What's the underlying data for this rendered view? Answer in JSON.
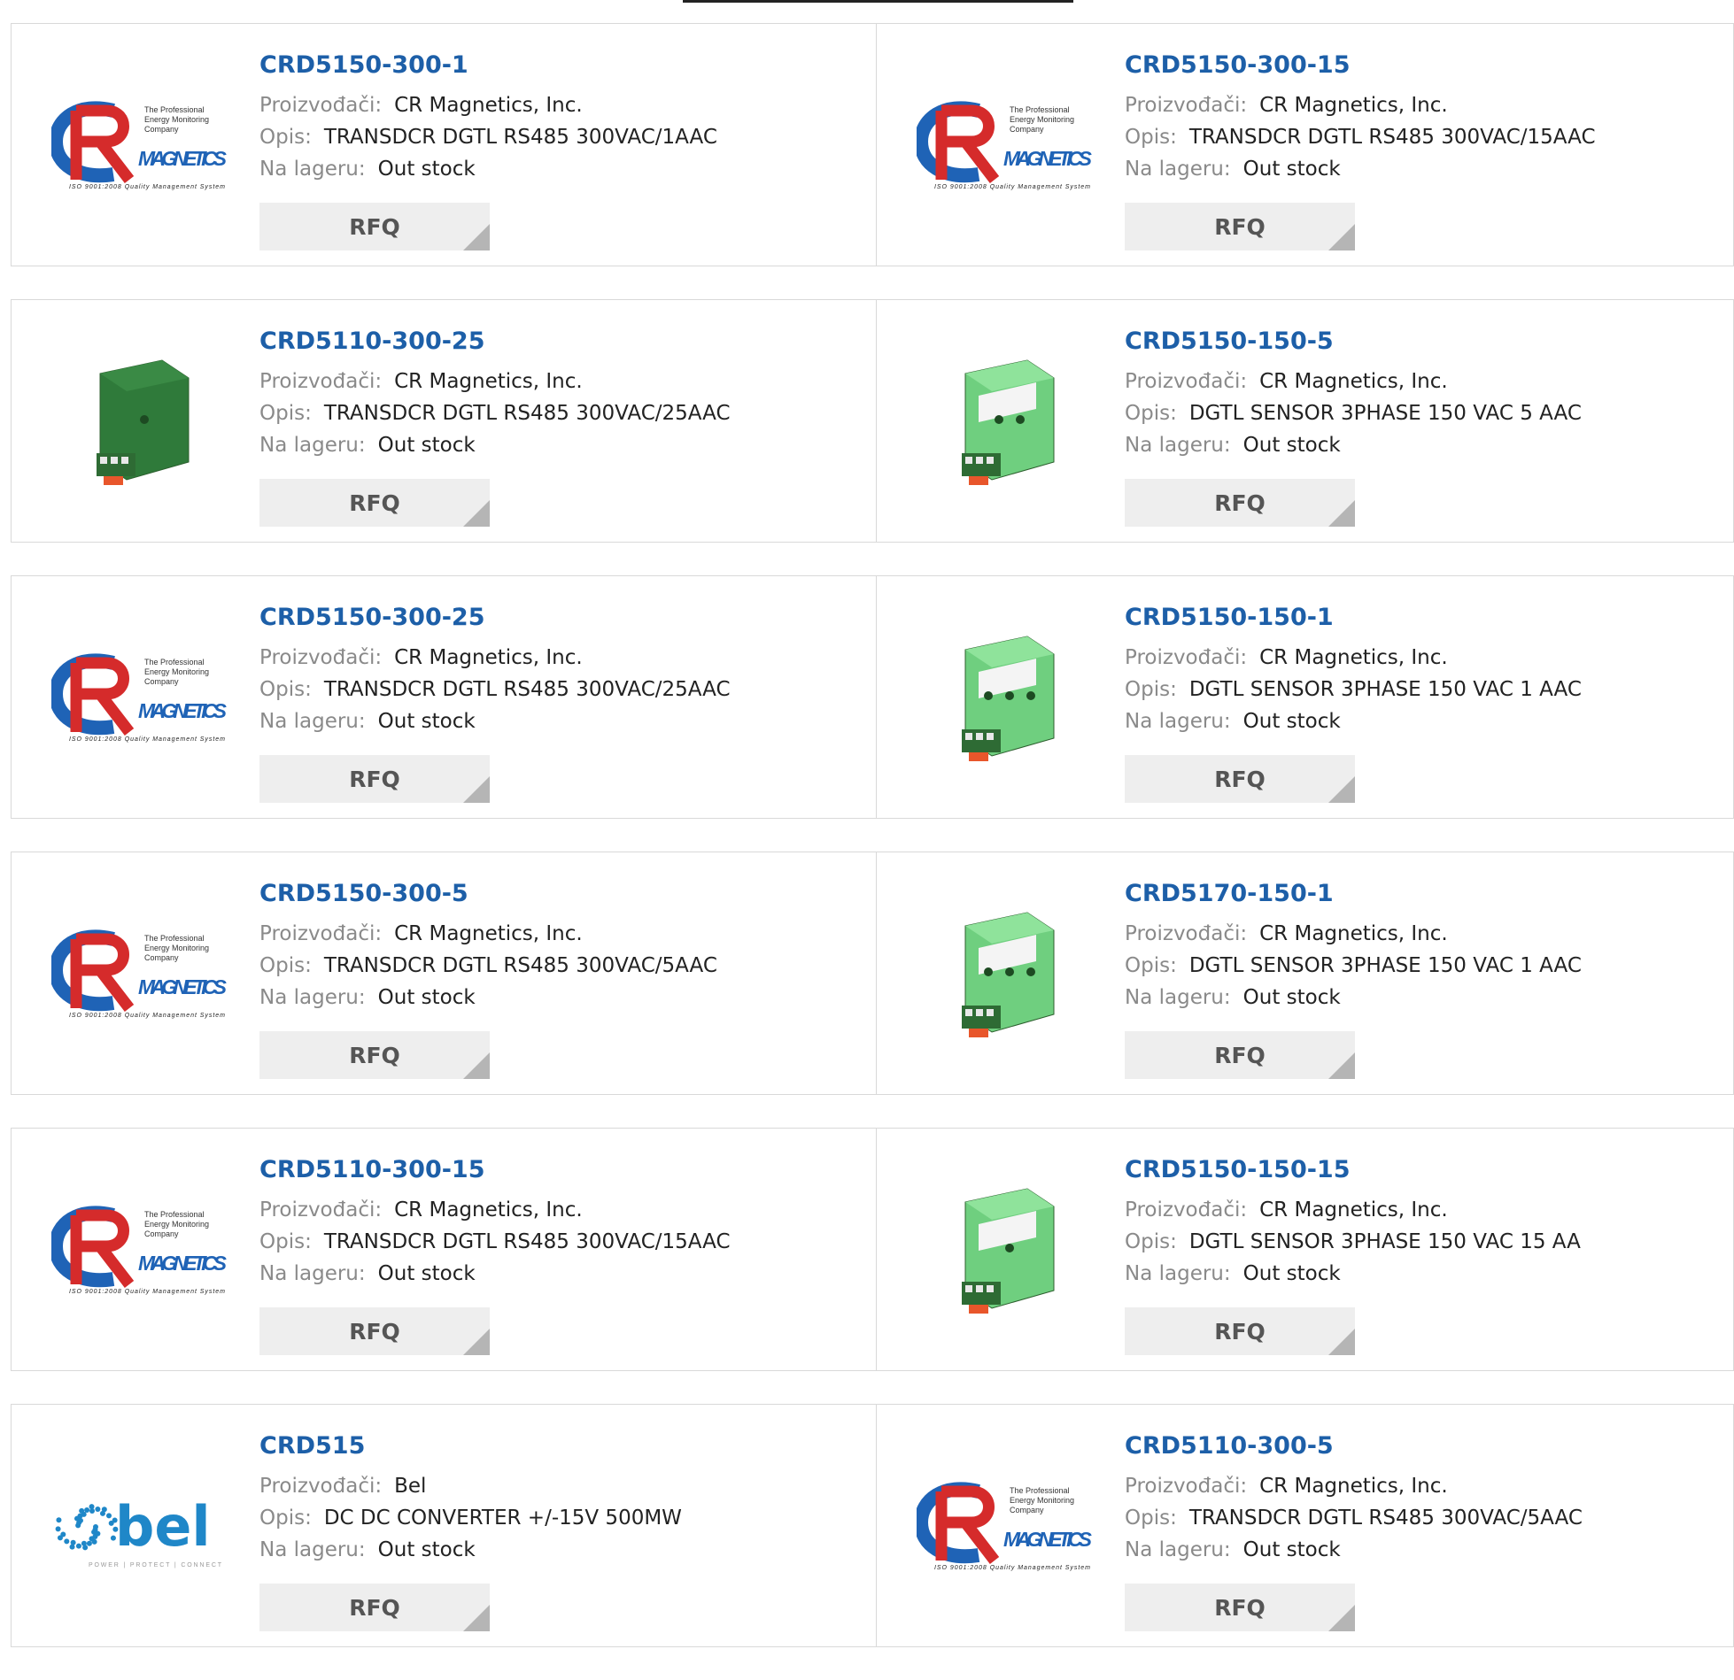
{
  "labels": {
    "manufacturer": "Proizvođači:",
    "description": "Opis:",
    "stock": "Na lageru:",
    "rfq": "RFQ"
  },
  "logo": {
    "cr_tagline": [
      "The Professional",
      "Energy Monitoring",
      "Company"
    ],
    "cr_word": "MAGNETICS",
    "cr_iso": "ISO 9001:2008 Quality Management System",
    "bel_word": "bel",
    "bel_tagline": "POWER | PROTECT | CONNECT"
  },
  "products": [
    {
      "part": "CRD5150-300-1",
      "manufacturer": "CR Magnetics, Inc.",
      "description": "TRANSDCR DGTL RS485 300VAC/1AAC",
      "stock": "Out stock",
      "image": "cr-logo"
    },
    {
      "part": "CRD5150-300-15",
      "manufacturer": "CR Magnetics, Inc.",
      "description": "TRANSDCR DGTL RS485 300VAC/15AAC",
      "stock": "Out stock",
      "image": "cr-logo"
    },
    {
      "part": "CRD5110-300-25",
      "manufacturer": "CR Magnetics, Inc.",
      "description": "TRANSDCR DGTL RS485 300VAC/25AAC",
      "stock": "Out stock",
      "image": "sensor-dark"
    },
    {
      "part": "CRD5150-150-5",
      "manufacturer": "CR Magnetics, Inc.",
      "description": "DGTL SENSOR 3PHASE 150 VAC 5 AAC",
      "stock": "Out stock",
      "image": "sensor-green-2"
    },
    {
      "part": "CRD5150-300-25",
      "manufacturer": "CR Magnetics, Inc.",
      "description": "TRANSDCR DGTL RS485 300VAC/25AAC",
      "stock": "Out stock",
      "image": "cr-logo"
    },
    {
      "part": "CRD5150-150-1",
      "manufacturer": "CR Magnetics, Inc.",
      "description": "DGTL SENSOR 3PHASE 150 VAC 1 AAC",
      "stock": "Out stock",
      "image": "sensor-green-3"
    },
    {
      "part": "CRD5150-300-5",
      "manufacturer": "CR Magnetics, Inc.",
      "description": "TRANSDCR DGTL RS485 300VAC/5AAC",
      "stock": "Out stock",
      "image": "cr-logo"
    },
    {
      "part": "CRD5170-150-1",
      "manufacturer": "CR Magnetics, Inc.",
      "description": "DGTL SENSOR 3PHASE 150 VAC 1 AAC",
      "stock": "Out stock",
      "image": "sensor-green-3"
    },
    {
      "part": "CRD5110-300-15",
      "manufacturer": "CR Magnetics, Inc.",
      "description": "TRANSDCR DGTL RS485 300VAC/15AAC",
      "stock": "Out stock",
      "image": "cr-logo"
    },
    {
      "part": "CRD5150-150-15",
      "manufacturer": "CR Magnetics, Inc.",
      "description": "DGTL SENSOR 3PHASE 150 VAC 15 AA",
      "stock": "Out stock",
      "image": "sensor-green-1"
    },
    {
      "part": "CRD515",
      "manufacturer": "Bel",
      "description": "DC DC CONVERTER +/-15V 500MW",
      "stock": "Out stock",
      "image": "bel-logo"
    },
    {
      "part": "CRD5110-300-5",
      "manufacturer": "CR Magnetics, Inc.",
      "description": "TRANSDCR DGTL RS485 300VAC/5AAC",
      "stock": "Out stock",
      "image": "cr-logo"
    }
  ],
  "colors": {
    "title": "#1d5fa8",
    "label": "#8a8a8a",
    "cr_red": "#d52b2b",
    "cr_blue": "#1f63b6",
    "bel_blue": "#1f87c8",
    "sensor_green": "#6fcf7f",
    "sensor_dark": "#2f7a3a"
  }
}
